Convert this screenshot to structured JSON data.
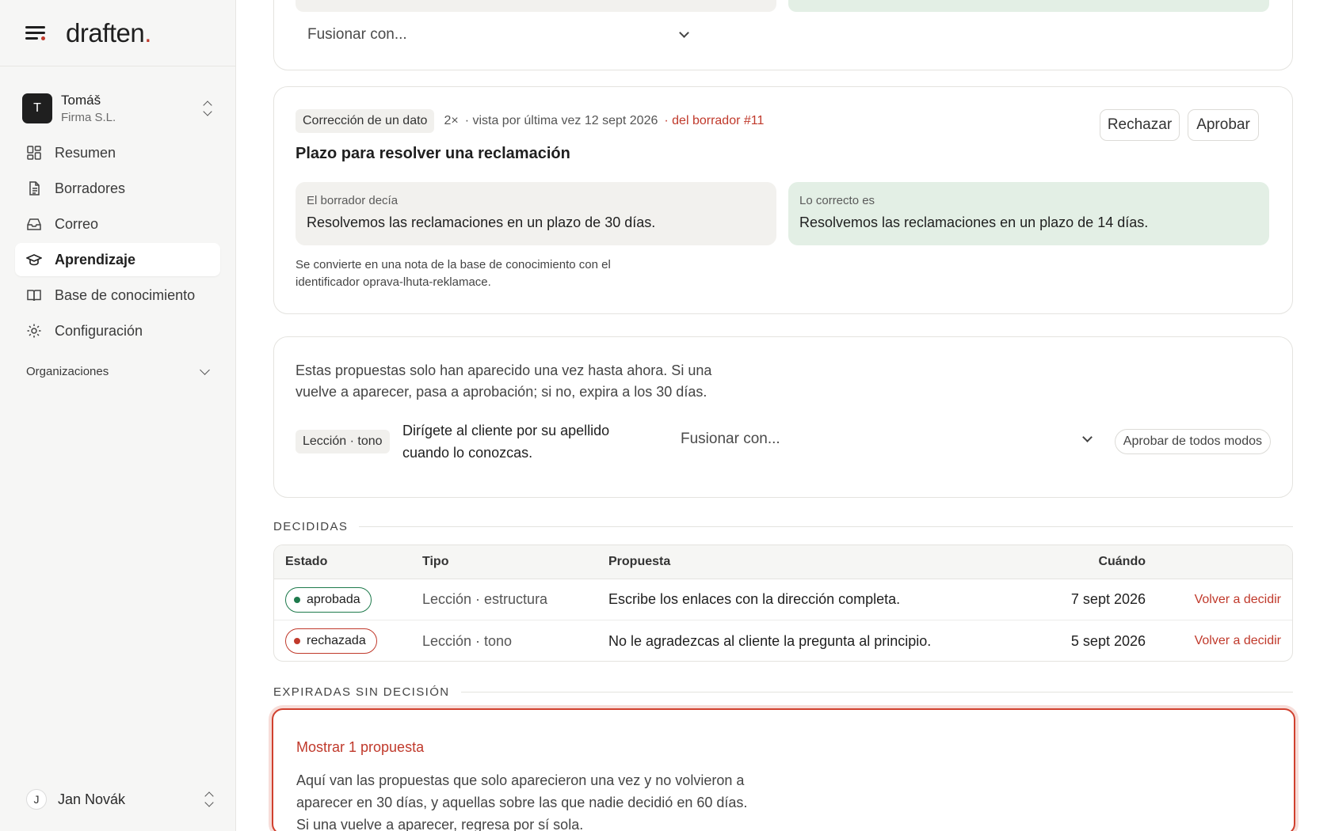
{
  "brand": {
    "logo_text": "draften",
    "logo_dot": "."
  },
  "org": {
    "initial": "T",
    "name": "Tomáš",
    "company": "Firma S.L."
  },
  "nav": [
    {
      "label": "Resumen",
      "icon": "dashboard-icon",
      "active": false
    },
    {
      "label": "Borradores",
      "icon": "document-icon",
      "active": false
    },
    {
      "label": "Correo",
      "icon": "inbox-icon",
      "active": false
    },
    {
      "label": "Aprendizaje",
      "icon": "graduation-cap-icon",
      "active": true
    },
    {
      "label": "Base de conocimiento",
      "icon": "book-icon",
      "active": false
    },
    {
      "label": "Configuración",
      "icon": "gear-icon",
      "active": false
    }
  ],
  "organizations_label": "Organizaciones",
  "user": {
    "initial": "J",
    "name": "Jan Novák"
  },
  "top_card": {
    "merge_placeholder": "Fusionar con..."
  },
  "fix_card": {
    "tag": "Corrección de un dato",
    "count": "2×",
    "seen": "· vista por última vez 12 sept 2026",
    "draft_link": "· del borrador #11",
    "reject_label": "Rechazar",
    "approve_label": "Aprobar",
    "title": "Plazo para resolver una reclamación",
    "old_label": "El borrador decía",
    "old_text": "Resolvemos las reclamaciones en un plazo de 30 días.",
    "new_label": "Lo correcto es",
    "new_text": "Resolvemos las reclamaciones en un plazo de 14 días.",
    "note": "Se convierte en una nota de la base de conocimiento con el identificador oprava-lhuta-reklamace."
  },
  "pending_card": {
    "description": "Estas propuestas solo han aparecido una vez hasta ahora. Si una vuelve a aparecer, pasa a aprobación; si no, expira a los 30 días.",
    "tag": "Lección · tono",
    "text": "Dirígete al cliente por su apellido cuando lo conozcas.",
    "merge_placeholder": "Fusionar con...",
    "approve_any_label": "Aprobar de todos modos"
  },
  "decided": {
    "heading": "DECIDIDAS",
    "columns": {
      "estado": "Estado",
      "tipo": "Tipo",
      "propuesta": "Propuesta",
      "cuando": "Cuándo"
    },
    "rows": [
      {
        "status": "aprobada",
        "status_kind": "approved",
        "type": "Lección · estructura",
        "proposal": "Escribe los enlaces con la dirección completa.",
        "when": "7 sept 2026",
        "action": "Volver a decidir"
      },
      {
        "status": "rechazada",
        "status_kind": "rejected",
        "type": "Lección · tono",
        "proposal": "No le agradezcas al cliente la pregunta al principio.",
        "when": "5 sept 2026",
        "action": "Volver a decidir"
      }
    ]
  },
  "expired": {
    "heading": "EXPIRADAS SIN DECISIÓN",
    "show_label": "Mostrar 1 propuesta",
    "description": "Aquí van las propuestas que solo aparecieron una vez y no volvieron a aparecer en 30 días, y aquellas sobre las que nadie decidió en 60 días. Si una vuelve a aparecer, regresa por sí sola."
  },
  "colors": {
    "accent": "#c0392b",
    "approved": "#1e7a4c",
    "correct_bg": "#e3efe5",
    "draft_bg": "#f2f1ee"
  }
}
